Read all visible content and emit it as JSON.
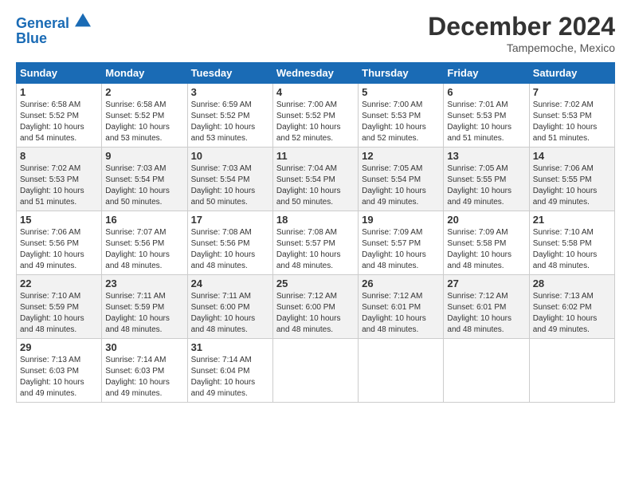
{
  "header": {
    "logo_line1": "General",
    "logo_line2": "Blue",
    "month": "December 2024",
    "location": "Tampemoche, Mexico"
  },
  "weekdays": [
    "Sunday",
    "Monday",
    "Tuesday",
    "Wednesday",
    "Thursday",
    "Friday",
    "Saturday"
  ],
  "weeks": [
    [
      {
        "day": "1",
        "info": "Sunrise: 6:58 AM\nSunset: 5:52 PM\nDaylight: 10 hours\nand 54 minutes."
      },
      {
        "day": "2",
        "info": "Sunrise: 6:58 AM\nSunset: 5:52 PM\nDaylight: 10 hours\nand 53 minutes."
      },
      {
        "day": "3",
        "info": "Sunrise: 6:59 AM\nSunset: 5:52 PM\nDaylight: 10 hours\nand 53 minutes."
      },
      {
        "day": "4",
        "info": "Sunrise: 7:00 AM\nSunset: 5:52 PM\nDaylight: 10 hours\nand 52 minutes."
      },
      {
        "day": "5",
        "info": "Sunrise: 7:00 AM\nSunset: 5:53 PM\nDaylight: 10 hours\nand 52 minutes."
      },
      {
        "day": "6",
        "info": "Sunrise: 7:01 AM\nSunset: 5:53 PM\nDaylight: 10 hours\nand 51 minutes."
      },
      {
        "day": "7",
        "info": "Sunrise: 7:02 AM\nSunset: 5:53 PM\nDaylight: 10 hours\nand 51 minutes."
      }
    ],
    [
      {
        "day": "8",
        "info": "Sunrise: 7:02 AM\nSunset: 5:53 PM\nDaylight: 10 hours\nand 51 minutes."
      },
      {
        "day": "9",
        "info": "Sunrise: 7:03 AM\nSunset: 5:54 PM\nDaylight: 10 hours\nand 50 minutes."
      },
      {
        "day": "10",
        "info": "Sunrise: 7:03 AM\nSunset: 5:54 PM\nDaylight: 10 hours\nand 50 minutes."
      },
      {
        "day": "11",
        "info": "Sunrise: 7:04 AM\nSunset: 5:54 PM\nDaylight: 10 hours\nand 50 minutes."
      },
      {
        "day": "12",
        "info": "Sunrise: 7:05 AM\nSunset: 5:54 PM\nDaylight: 10 hours\nand 49 minutes."
      },
      {
        "day": "13",
        "info": "Sunrise: 7:05 AM\nSunset: 5:55 PM\nDaylight: 10 hours\nand 49 minutes."
      },
      {
        "day": "14",
        "info": "Sunrise: 7:06 AM\nSunset: 5:55 PM\nDaylight: 10 hours\nand 49 minutes."
      }
    ],
    [
      {
        "day": "15",
        "info": "Sunrise: 7:06 AM\nSunset: 5:56 PM\nDaylight: 10 hours\nand 49 minutes."
      },
      {
        "day": "16",
        "info": "Sunrise: 7:07 AM\nSunset: 5:56 PM\nDaylight: 10 hours\nand 48 minutes."
      },
      {
        "day": "17",
        "info": "Sunrise: 7:08 AM\nSunset: 5:56 PM\nDaylight: 10 hours\nand 48 minutes."
      },
      {
        "day": "18",
        "info": "Sunrise: 7:08 AM\nSunset: 5:57 PM\nDaylight: 10 hours\nand 48 minutes."
      },
      {
        "day": "19",
        "info": "Sunrise: 7:09 AM\nSunset: 5:57 PM\nDaylight: 10 hours\nand 48 minutes."
      },
      {
        "day": "20",
        "info": "Sunrise: 7:09 AM\nSunset: 5:58 PM\nDaylight: 10 hours\nand 48 minutes."
      },
      {
        "day": "21",
        "info": "Sunrise: 7:10 AM\nSunset: 5:58 PM\nDaylight: 10 hours\nand 48 minutes."
      }
    ],
    [
      {
        "day": "22",
        "info": "Sunrise: 7:10 AM\nSunset: 5:59 PM\nDaylight: 10 hours\nand 48 minutes."
      },
      {
        "day": "23",
        "info": "Sunrise: 7:11 AM\nSunset: 5:59 PM\nDaylight: 10 hours\nand 48 minutes."
      },
      {
        "day": "24",
        "info": "Sunrise: 7:11 AM\nSunset: 6:00 PM\nDaylight: 10 hours\nand 48 minutes."
      },
      {
        "day": "25",
        "info": "Sunrise: 7:12 AM\nSunset: 6:00 PM\nDaylight: 10 hours\nand 48 minutes."
      },
      {
        "day": "26",
        "info": "Sunrise: 7:12 AM\nSunset: 6:01 PM\nDaylight: 10 hours\nand 48 minutes."
      },
      {
        "day": "27",
        "info": "Sunrise: 7:12 AM\nSunset: 6:01 PM\nDaylight: 10 hours\nand 48 minutes."
      },
      {
        "day": "28",
        "info": "Sunrise: 7:13 AM\nSunset: 6:02 PM\nDaylight: 10 hours\nand 49 minutes."
      }
    ],
    [
      {
        "day": "29",
        "info": "Sunrise: 7:13 AM\nSunset: 6:03 PM\nDaylight: 10 hours\nand 49 minutes."
      },
      {
        "day": "30",
        "info": "Sunrise: 7:14 AM\nSunset: 6:03 PM\nDaylight: 10 hours\nand 49 minutes."
      },
      {
        "day": "31",
        "info": "Sunrise: 7:14 AM\nSunset: 6:04 PM\nDaylight: 10 hours\nand 49 minutes."
      },
      null,
      null,
      null,
      null
    ]
  ]
}
